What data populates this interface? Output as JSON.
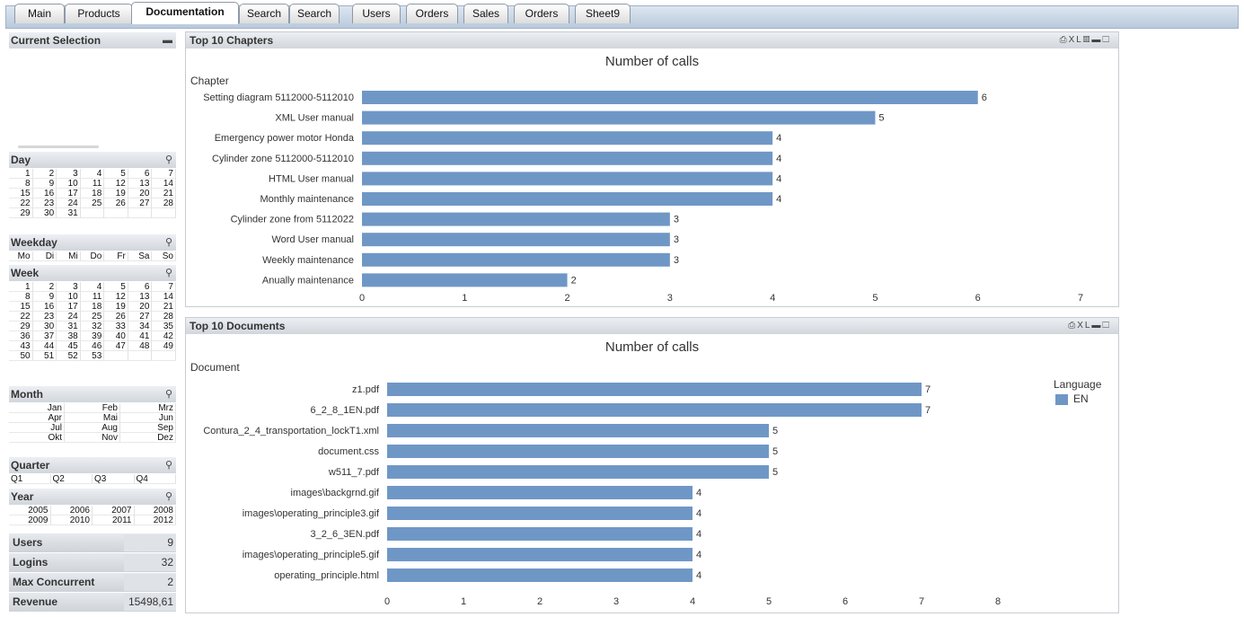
{
  "tabs": [
    {
      "label": "Main",
      "active": false
    },
    {
      "label": "Products",
      "active": false
    },
    {
      "label": "Documentation",
      "active": true
    },
    {
      "label": "Search",
      "active": false
    },
    {
      "label": "Search",
      "active": false
    },
    {
      "label": "Users",
      "active": false
    },
    {
      "label": "Orders",
      "active": false
    },
    {
      "label": "Sales",
      "active": false
    },
    {
      "label": "Orders",
      "active": false
    },
    {
      "label": "Sheet9",
      "active": false
    }
  ],
  "left": {
    "current_selection": "Current Selection",
    "day_title": "Day",
    "days": [
      "1",
      "2",
      "3",
      "4",
      "5",
      "6",
      "7",
      "8",
      "9",
      "10",
      "11",
      "12",
      "13",
      "14",
      "15",
      "16",
      "17",
      "18",
      "19",
      "20",
      "21",
      "22",
      "23",
      "24",
      "25",
      "26",
      "27",
      "28",
      "29",
      "30",
      "31"
    ],
    "weekday_title": "Weekday",
    "weekdays": [
      "Mo",
      "Di",
      "Mi",
      "Do",
      "Fr",
      "Sa",
      "So"
    ],
    "week_title": "Week",
    "weeks": [
      "1",
      "2",
      "3",
      "4",
      "5",
      "6",
      "7",
      "8",
      "9",
      "10",
      "11",
      "12",
      "13",
      "14",
      "15",
      "16",
      "17",
      "18",
      "19",
      "20",
      "21",
      "22",
      "23",
      "24",
      "25",
      "26",
      "27",
      "28",
      "29",
      "30",
      "31",
      "32",
      "33",
      "34",
      "35",
      "36",
      "37",
      "38",
      "39",
      "40",
      "41",
      "42",
      "43",
      "44",
      "45",
      "46",
      "47",
      "48",
      "49",
      "50",
      "51",
      "52",
      "53"
    ],
    "month_title": "Month",
    "months": [
      "Jan",
      "Feb",
      "Mrz",
      "Apr",
      "Mai",
      "Jun",
      "Jul",
      "Aug",
      "Sep",
      "Okt",
      "Nov",
      "Dez"
    ],
    "quarter_title": "Quarter",
    "quarters": [
      "Q1",
      "Q2",
      "Q3",
      "Q4"
    ],
    "year_title": "Year",
    "years": [
      "2005",
      "2006",
      "2007",
      "2008",
      "2009",
      "2010",
      "2011",
      "2012"
    ],
    "stats": [
      {
        "label": "Users",
        "value": "9"
      },
      {
        "label": "Logins",
        "value": "32"
      },
      {
        "label": "Max Concurrent",
        "value": "2"
      },
      {
        "label": "Revenue",
        "value": "15498,61"
      }
    ]
  },
  "colors": {
    "bar": "#6f97c6"
  },
  "chart_data": [
    {
      "type": "bar",
      "orientation": "horizontal",
      "panel_title": "Top 10 Chapters",
      "title": "Number of calls",
      "ylabel": "Chapter",
      "categories": [
        "Setting diagram 5112000-5112010",
        "XML User manual",
        "Emergency power motor Honda",
        "Cylinder zone 5112000-5112010",
        "HTML User manual",
        "Monthly maintenance",
        "Cylinder zone from 5112022",
        "Word User manual",
        "Weekly maintenance",
        "Anually maintenance"
      ],
      "values": [
        6,
        5,
        4,
        4,
        4,
        4,
        3,
        3,
        3,
        2
      ],
      "xlim": [
        0,
        7
      ],
      "ticks": [
        "0",
        "1",
        "2",
        "3",
        "4",
        "5",
        "6",
        "7"
      ]
    },
    {
      "type": "bar",
      "orientation": "horizontal",
      "panel_title": "Top 10 Documents",
      "title": "Number of calls",
      "ylabel": "Document",
      "categories": [
        "z1.pdf",
        "6_2_8_1EN.pdf",
        "Contura_2_4_transportation_lockT1.xml",
        "document.css",
        "w511_7.pdf",
        "images\\backgrnd.gif",
        "images\\operating_principle3.gif",
        "3_2_6_3EN.pdf",
        "images\\operating_principle5.gif",
        "operating_principle.html"
      ],
      "values": [
        7,
        7,
        5,
        5,
        5,
        4,
        4,
        4,
        4,
        4
      ],
      "xlim": [
        0,
        8
      ],
      "ticks": [
        "0",
        "1",
        "2",
        "3",
        "4",
        "5",
        "6",
        "7",
        "8"
      ],
      "legend_title": "Language",
      "legend": [
        "EN"
      ]
    }
  ]
}
